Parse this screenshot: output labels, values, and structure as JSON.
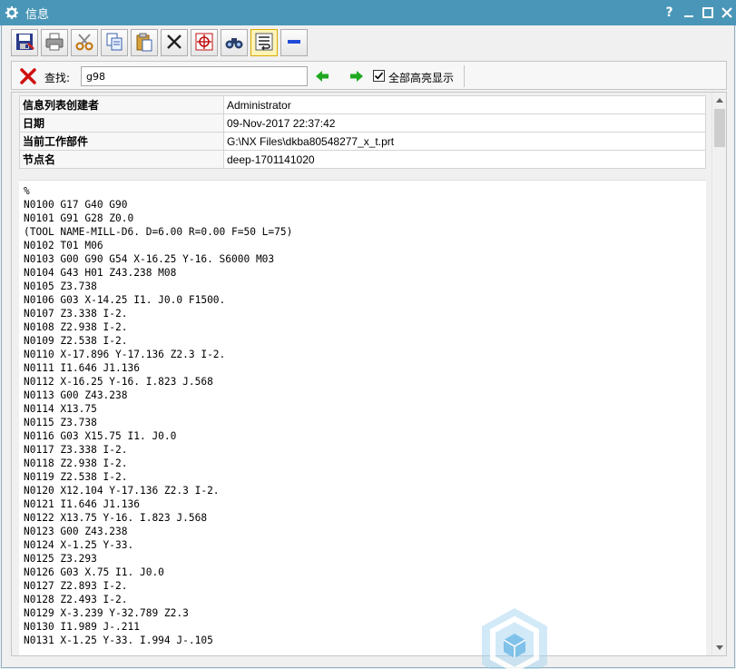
{
  "window": {
    "title": "信息",
    "help_label": "?",
    "min_label": "_",
    "max_label": "□",
    "close_label": "X"
  },
  "toolbar": {
    "buttons": [
      {
        "name": "save-icon"
      },
      {
        "name": "print-icon"
      },
      {
        "name": "cut-icon"
      },
      {
        "name": "copy-icon"
      },
      {
        "name": "paste-icon"
      },
      {
        "name": "delete-icon"
      },
      {
        "name": "target-icon"
      },
      {
        "name": "binoculars-icon"
      },
      {
        "name": "wrap-text-icon"
      },
      {
        "name": "minimize-panel-icon"
      }
    ]
  },
  "find": {
    "label": "查找:",
    "value": "g98",
    "highlight_all_label": "全部高亮显示",
    "highlight_all_checked": true
  },
  "meta": {
    "rows": [
      {
        "key": "信息列表创建者",
        "value": "Administrator"
      },
      {
        "key": "日期",
        "value": "09-Nov-2017 22:37:42"
      },
      {
        "key": "当前工作部件",
        "value": "G:\\NX Files\\dkba80548277_x_t.prt"
      },
      {
        "key": "节点名",
        "value": "deep-1701141020"
      }
    ]
  },
  "code": {
    "lines": [
      "%",
      "N0100 G17 G40 G90",
      "N0101 G91 G28 Z0.0",
      "(TOOL NAME-MILL-D6. D=6.00 R=0.00 F=50 L=75)",
      "N0102 T01 M06",
      "N0103 G00 G90 G54 X-16.25 Y-16. S6000 M03",
      "N0104 G43 H01 Z43.238 M08",
      "N0105 Z3.738",
      "N0106 G03 X-14.25 I1. J0.0 F1500.",
      "N0107 Z3.338 I-2.",
      "N0108 Z2.938 I-2.",
      "N0109 Z2.538 I-2.",
      "N0110 X-17.896 Y-17.136 Z2.3 I-2.",
      "N0111 I1.646 J1.136",
      "N0112 X-16.25 Y-16. I.823 J.568",
      "N0113 G00 Z43.238",
      "N0114 X13.75",
      "N0115 Z3.738",
      "N0116 G03 X15.75 I1. J0.0",
      "N0117 Z3.338 I-2.",
      "N0118 Z2.938 I-2.",
      "N0119 Z2.538 I-2.",
      "N0120 X12.104 Y-17.136 Z2.3 I-2.",
      "N0121 I1.646 J1.136",
      "N0122 X13.75 Y-16. I.823 J.568",
      "N0123 G00 Z43.238",
      "N0124 X-1.25 Y-33.",
      "N0125 Z3.293",
      "N0126 G03 X.75 I1. J0.0",
      "N0127 Z2.893 I-2.",
      "N0128 Z2.493 I-2.",
      "N0129 X-3.239 Y-32.789 Z2.3",
      "N0130 I1.989 J-.211",
      "N0131 X-1.25 Y-33. I.994 J-.105"
    ]
  },
  "colors": {
    "titlebar": "#4a96b8",
    "close_red": "#d01010",
    "arrow_green": "#1fa81f"
  }
}
